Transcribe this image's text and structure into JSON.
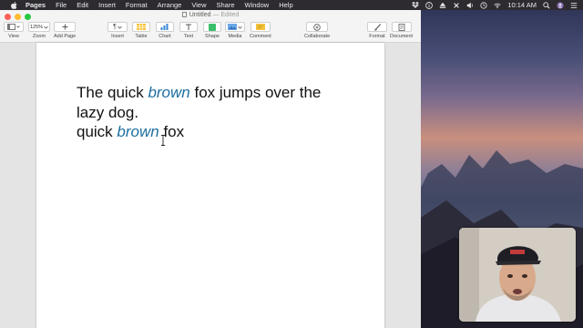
{
  "menubar": {
    "app_name": "Pages",
    "items": [
      "File",
      "Edit",
      "Insert",
      "Format",
      "Arrange",
      "View",
      "Share",
      "Window",
      "Help"
    ],
    "clock": "10:14 AM",
    "status_icons": [
      "dropbox-icon",
      "info-icon",
      "eject-icon",
      "close-x-icon",
      "volume-icon",
      "time-machine-icon",
      "wifi-icon",
      "search-icon",
      "user-icon",
      "list-icon"
    ]
  },
  "window": {
    "title": "Untitled",
    "title_suffix": "— Edited"
  },
  "toolbar": {
    "view_label": "View",
    "zoom_value": "125%",
    "zoom_label": "Zoom",
    "add_page_label": "Add Page",
    "insert_label": "Insert",
    "table_label": "Table",
    "chart_label": "Chart",
    "text_label": "Text",
    "shape_label": "Shape",
    "media_label": "Media",
    "comment_label": "Comment",
    "collaborate_label": "Collaborate",
    "format_label": "Format",
    "document_label": "Document"
  },
  "document": {
    "line1_a": "The quick ",
    "line1_b": "brown",
    "line1_c": " fox jumps over the",
    "line2": "lazy dog.",
    "line3_a": "quick ",
    "line3_b": "brown",
    "line3_c": " fox"
  },
  "colors": {
    "italic_word": "#1e6fa0",
    "close": "#fd5f57",
    "minimize": "#febc2e",
    "maximize": "#28c840"
  }
}
